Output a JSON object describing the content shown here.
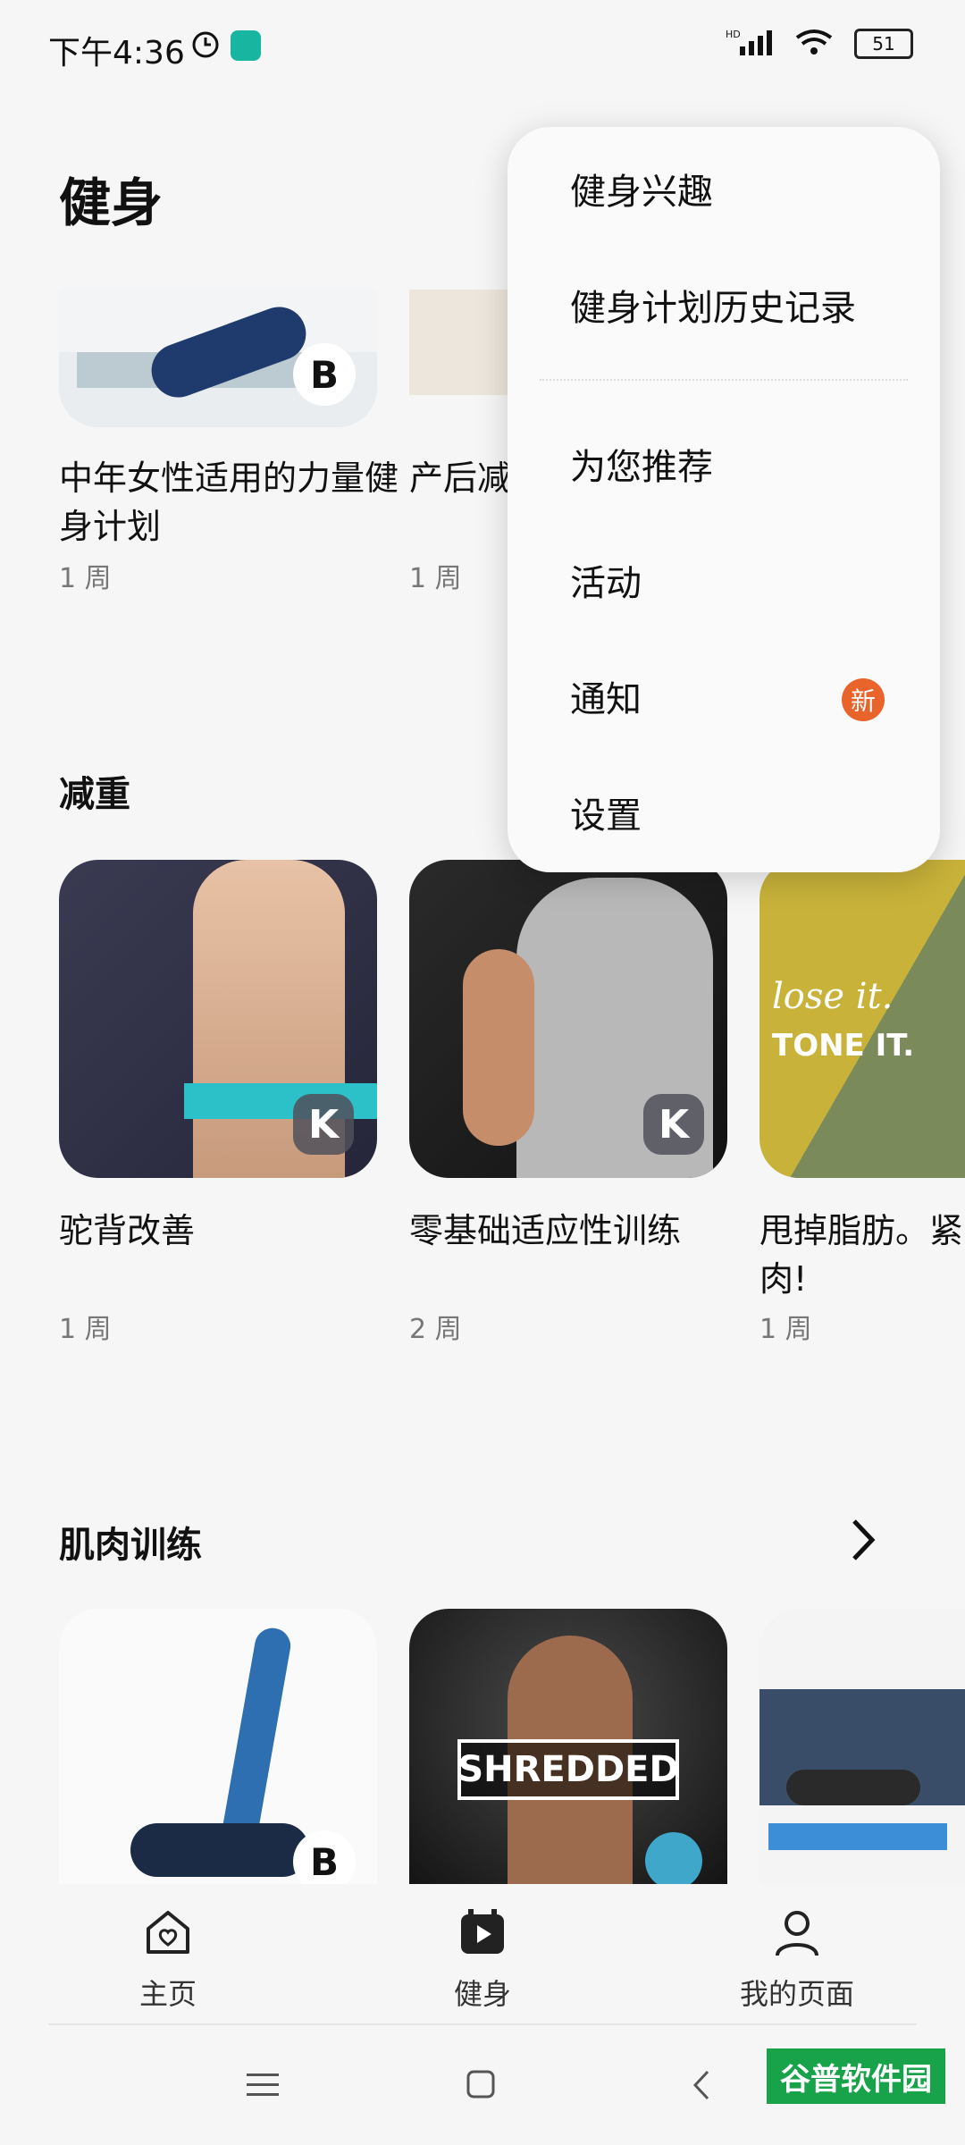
{
  "status_bar": {
    "time": "下午4:36",
    "battery": "51"
  },
  "page": {
    "title": "健身"
  },
  "top_row": [
    {
      "title": "中年女性适用的力量健身计划",
      "duration": "1 周"
    },
    {
      "title": "产后减…操",
      "duration": "1 周"
    }
  ],
  "sections": {
    "weight_loss": {
      "title": "减重",
      "cards": [
        {
          "title": "驼背改善",
          "duration": "1 周"
        },
        {
          "title": "零基础适应性训练",
          "duration": "2 周"
        },
        {
          "title": "甩掉脂肪。紧肉!",
          "duration": "1 周",
          "image_text_1": "lose it.",
          "image_text_2": "TONE IT."
        }
      ]
    },
    "muscle": {
      "title": "肌肉训练",
      "cards": [
        {
          "image_text": ""
        },
        {
          "image_text": "SHREDDED"
        },
        {
          "image_text": ""
        }
      ]
    }
  },
  "menu": {
    "items": [
      "健身兴趣",
      "健身计划历史记录",
      "为您推荐",
      "活动",
      "通知",
      "设置"
    ],
    "new_badge": "新"
  },
  "bottom_nav": {
    "items": [
      {
        "label": "主页",
        "icon": "home-heart-icon"
      },
      {
        "label": "健身",
        "icon": "play-calendar-icon"
      },
      {
        "label": "我的页面",
        "icon": "person-icon"
      }
    ]
  },
  "watermark": "谷普软件园"
}
